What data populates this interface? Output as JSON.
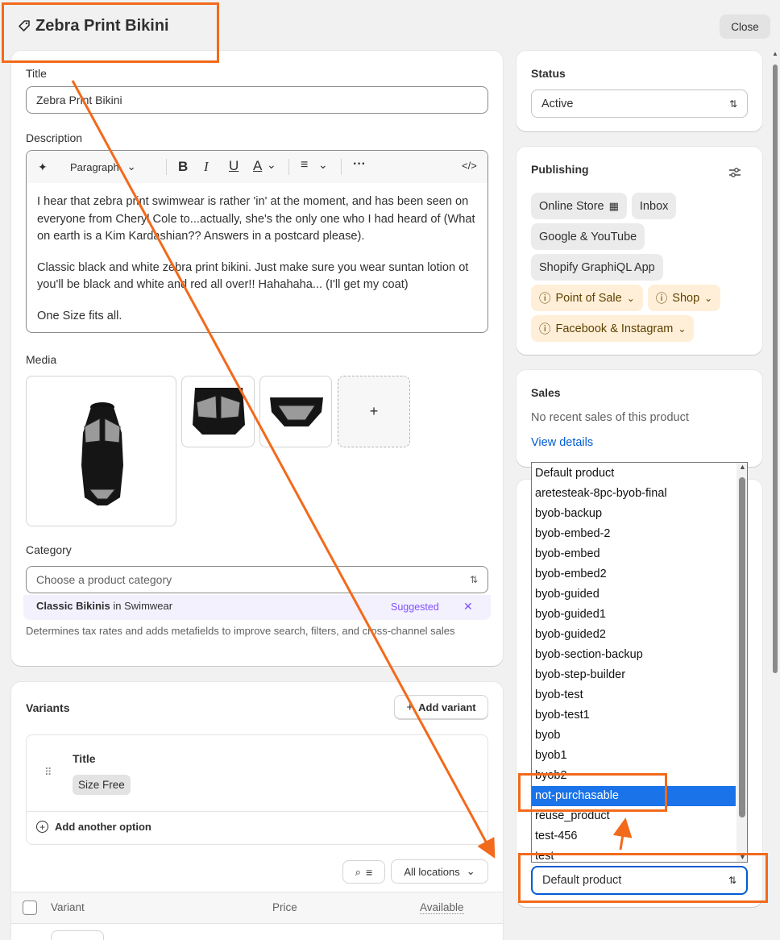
{
  "header": {
    "title": "Zebra Print Bikini",
    "close_label": "Close"
  },
  "product": {
    "title_label": "Title",
    "title_value": "Zebra Print Bikini",
    "description_label": "Description",
    "toolbar": {
      "paragraph_label": "Paragraph"
    },
    "description": {
      "p1": "I hear that zebra print swimwear is rather 'in' at the moment, and has been seen on everyone from Cheryl Cole to...actually, she's the only one who I had heard of (What on earth is a Kim Kardashian?? Answers in a postcard please).",
      "p2": "Classic black and white zebra print bikini. Just make sure you wear suntan lotion ot you'll be black and white and red all over!! Hahahaha... (I'll get my coat)",
      "p3": "One Size fits all."
    },
    "media_label": "Media",
    "media_add": "+",
    "category_label": "Category",
    "category_placeholder": "Choose a product category",
    "suggestion": {
      "name": "Classic Bikinis",
      "connector": " in Swimwear",
      "badge": "Suggested",
      "dismiss": "✕"
    },
    "category_help": "Determines tax rates and adds metafields to improve search, filters, and cross-channel sales"
  },
  "variants": {
    "heading": "Variants",
    "add_variant_label": "Add variant",
    "option_name": "Title",
    "option_value": "Size Free",
    "add_option_label": "Add another option",
    "locations_label": "All locations",
    "columns": {
      "variant": "Variant",
      "price": "Price",
      "available": "Available"
    }
  },
  "status": {
    "heading": "Status",
    "value": "Active"
  },
  "publishing": {
    "heading": "Publishing",
    "channels": [
      {
        "label": "Online Store",
        "icon": "calendar-clock-icon"
      },
      {
        "label": "Inbox"
      },
      {
        "label": "Google & YouTube"
      },
      {
        "label": "Shopify GraphiQL App"
      }
    ],
    "warn_channels": [
      {
        "label": "Point of Sale"
      },
      {
        "label": "Shop"
      },
      {
        "label": "Facebook & Instagram"
      }
    ]
  },
  "sales": {
    "heading": "Sales",
    "text": "No recent sales of this product",
    "link": "View details"
  },
  "template": {
    "options": [
      "Default product",
      "aretesteak-8pc-byob-final",
      "byob-backup",
      "byob-embed-2",
      "byob-embed",
      "byob-embed2",
      "byob-guided",
      "byob-guided1",
      "byob-guided2",
      "byob-section-backup",
      "byob-step-builder",
      "byob-test",
      "byob-test1",
      "byob",
      "byob1",
      "byob2",
      "not-purchasable",
      "reuse_product",
      "test-456",
      "test"
    ],
    "selected_index": 16,
    "current_value": "Default product"
  },
  "colors": {
    "accent_orange": "#f26a1b",
    "select_blue": "#1a73e8",
    "link_blue": "#005bd3",
    "suggested_purple": "#8051ff"
  }
}
